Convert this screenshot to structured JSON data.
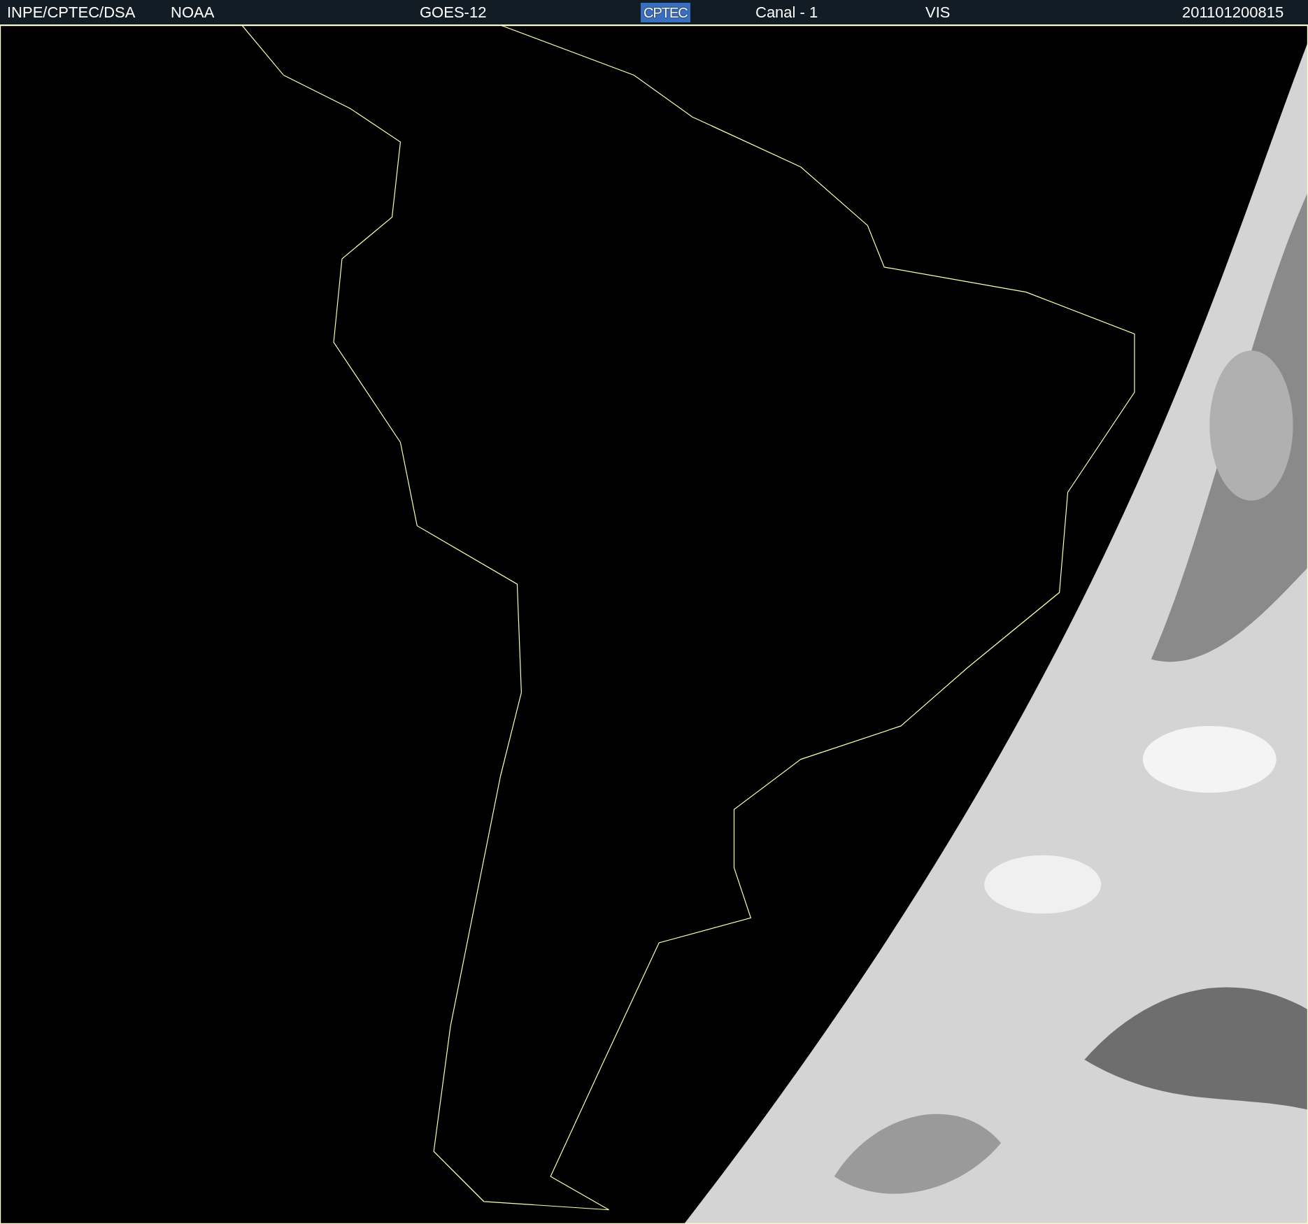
{
  "header": {
    "organization": "INPE/CPTEC/DSA",
    "agency": "NOAA",
    "satellite": "GOES-12",
    "logo": "CPTEC",
    "channel": "Canal - 1",
    "band": "VIS",
    "timestamp": "201101200815"
  }
}
